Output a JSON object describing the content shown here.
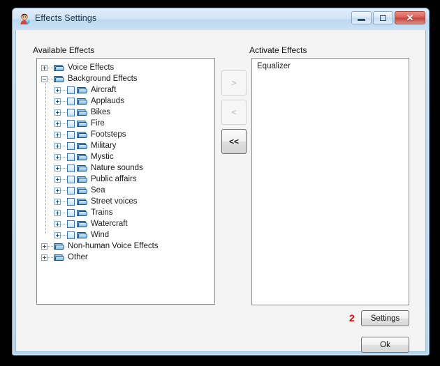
{
  "window": {
    "title": "Effects Settings",
    "app_icon": "person-face-icon",
    "caption_buttons": [
      {
        "name": "minimize",
        "label": "minimize-icon"
      },
      {
        "name": "maximize",
        "label": "maximize-icon"
      },
      {
        "name": "close",
        "label": "✕"
      }
    ]
  },
  "labels": {
    "available": "Available Effects",
    "activate": "Activate Effects"
  },
  "tree": {
    "items": [
      {
        "level": 0,
        "expander": "plus",
        "checkbox": false,
        "label": "Voice Effects"
      },
      {
        "level": 0,
        "expander": "minus",
        "checkbox": false,
        "label": "Background Effects"
      },
      {
        "level": 1,
        "expander": "plus",
        "checkbox": true,
        "label": "Aircraft"
      },
      {
        "level": 1,
        "expander": "plus",
        "checkbox": true,
        "label": "Applauds"
      },
      {
        "level": 1,
        "expander": "plus",
        "checkbox": true,
        "label": "Bikes"
      },
      {
        "level": 1,
        "expander": "plus",
        "checkbox": true,
        "label": "Fire"
      },
      {
        "level": 1,
        "expander": "plus",
        "checkbox": true,
        "label": "Footsteps"
      },
      {
        "level": 1,
        "expander": "plus",
        "checkbox": true,
        "label": "Military"
      },
      {
        "level": 1,
        "expander": "plus",
        "checkbox": true,
        "label": "Mystic"
      },
      {
        "level": 1,
        "expander": "plus",
        "checkbox": true,
        "label": "Nature sounds"
      },
      {
        "level": 1,
        "expander": "plus",
        "checkbox": true,
        "label": "Public affairs"
      },
      {
        "level": 1,
        "expander": "plus",
        "checkbox": true,
        "label": "Sea"
      },
      {
        "level": 1,
        "expander": "plus",
        "checkbox": true,
        "label": "Street voices"
      },
      {
        "level": 1,
        "expander": "plus",
        "checkbox": true,
        "label": "Trains"
      },
      {
        "level": 1,
        "expander": "plus",
        "checkbox": true,
        "label": "Watercraft"
      },
      {
        "level": 1,
        "expander": "plus",
        "checkbox": true,
        "label": "Wind"
      },
      {
        "level": 0,
        "expander": "plus",
        "checkbox": false,
        "label": "Non-human Voice Effects"
      },
      {
        "level": 0,
        "expander": "plus",
        "checkbox": false,
        "label": "Other"
      }
    ]
  },
  "transfer_buttons": [
    {
      "name": "add-effect-button",
      "label": ">",
      "enabled": false
    },
    {
      "name": "remove-effect-button",
      "label": "<",
      "enabled": false
    },
    {
      "name": "clear-effects-button",
      "label": "<<",
      "enabled": true
    }
  ],
  "active_effects": {
    "items": [
      "Equalizer"
    ]
  },
  "footer": {
    "settings_label": "Settings",
    "ok_label": "Ok",
    "marker": "2"
  },
  "colors": {
    "marker_red": "#e00000",
    "frame_blue": "#c3dcf0",
    "close_red": "#c2453c"
  }
}
